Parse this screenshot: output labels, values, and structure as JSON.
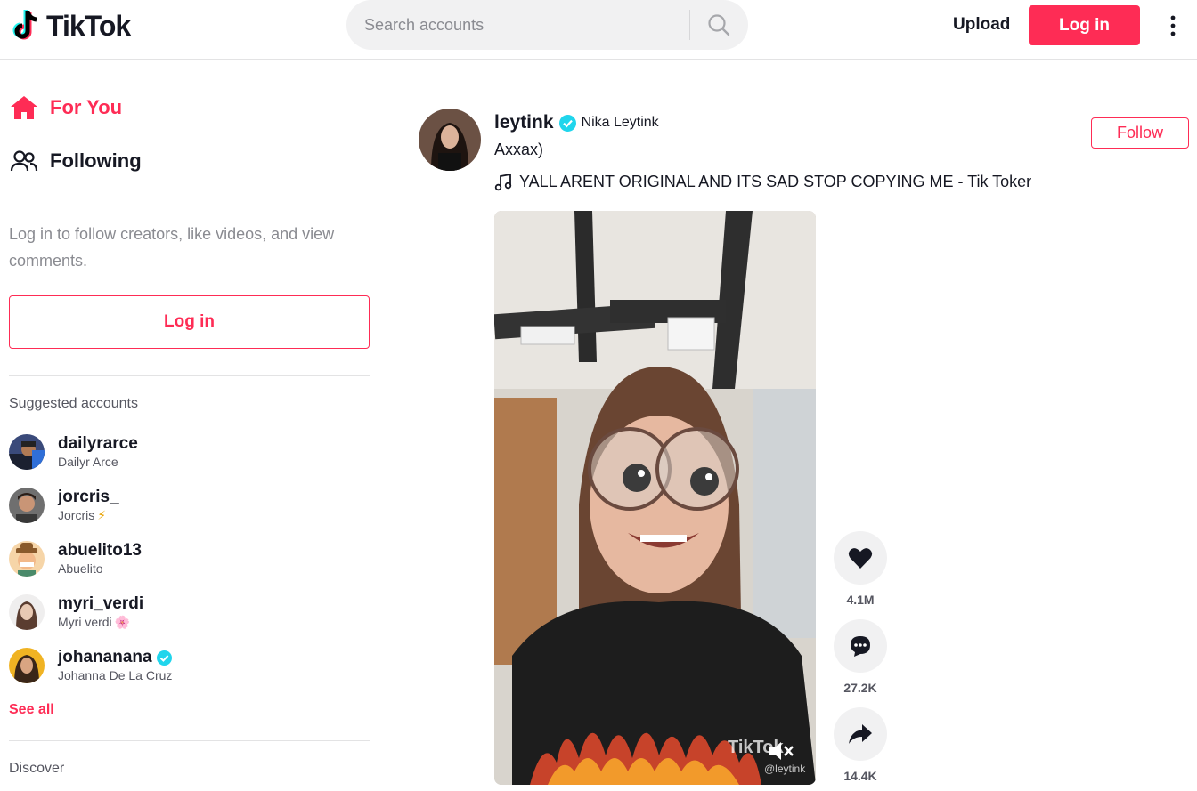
{
  "header": {
    "logo_text": "TikTok",
    "search_placeholder": "Search accounts",
    "upload_label": "Upload",
    "login_label": "Log in"
  },
  "sidebar": {
    "nav": [
      {
        "label": "For You",
        "icon": "home-icon",
        "active": true
      },
      {
        "label": "Following",
        "icon": "people-icon",
        "active": false
      }
    ],
    "login_hint": "Log in to follow creators, like videos, and view comments.",
    "login_button": "Log in",
    "suggested_title": "Suggested accounts",
    "accounts": [
      {
        "username": "dailyrarce",
        "name": "Dailyr Arce",
        "verified": false,
        "emoji": ""
      },
      {
        "username": "jorcris_",
        "name": "Jorcris",
        "verified": false,
        "emoji": "⚡"
      },
      {
        "username": "abuelito13",
        "name": "Abuelito",
        "verified": false,
        "emoji": ""
      },
      {
        "username": "myri_verdi",
        "name": "Myri verdi",
        "verified": false,
        "emoji": "🌸"
      },
      {
        "username": "johananana",
        "name": "Johanna De La Cruz",
        "verified": true,
        "emoji": ""
      }
    ],
    "see_all": "See all",
    "discover_title": "Discover"
  },
  "post": {
    "username": "leytink",
    "nickname": "Nika Leytink",
    "verified": true,
    "caption": "Axxax)",
    "music": "YALL ARENT ORIGINAL AND ITS SAD STOP COPYING ME - Tik Toker",
    "follow_label": "Follow",
    "watermark_brand": "TikTok",
    "watermark_user": "@leytink",
    "likes": "4.1M",
    "comments": "27.2K",
    "shares": "14.4K"
  },
  "colors": {
    "brand": "#fe2c55",
    "verified": "#20d5ec",
    "text": "#161823",
    "muted": "#8a8b91"
  }
}
